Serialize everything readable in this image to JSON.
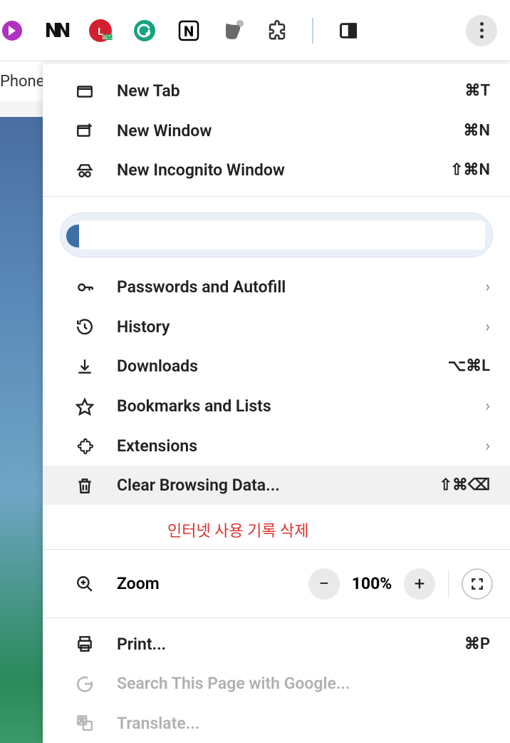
{
  "tabbar": {
    "label": "Phone"
  },
  "toolbar_ext_icons": [
    "generic",
    "newspaper",
    "lastpass",
    "grammarly",
    "notion",
    "evernote",
    "puzzle",
    "sidepanel"
  ],
  "menu": {
    "newTab": {
      "label": "New Tab",
      "shortcut": "⌘T"
    },
    "newWindow": {
      "label": "New Window",
      "shortcut": "⌘N"
    },
    "incognito": {
      "label": "New Incognito Window",
      "shortcut": "⇧⌘N"
    },
    "passwords": {
      "label": "Passwords and Autofill"
    },
    "history": {
      "label": "History"
    },
    "downloads": {
      "label": "Downloads",
      "shortcut": "⌥⌘L"
    },
    "bookmarks": {
      "label": "Bookmarks and Lists"
    },
    "extensions": {
      "label": "Extensions"
    },
    "clear": {
      "label": "Clear Browsing Data...",
      "shortcut": "⇧⌘⌫"
    },
    "zoom": {
      "label": "Zoom",
      "value": "100%"
    },
    "print": {
      "label": "Print...",
      "shortcut": "⌘P"
    },
    "search": {
      "label": "Search This Page with Google..."
    },
    "translate": {
      "label": "Translate..."
    }
  },
  "annotation": "인터넷 사용 기록 삭제"
}
